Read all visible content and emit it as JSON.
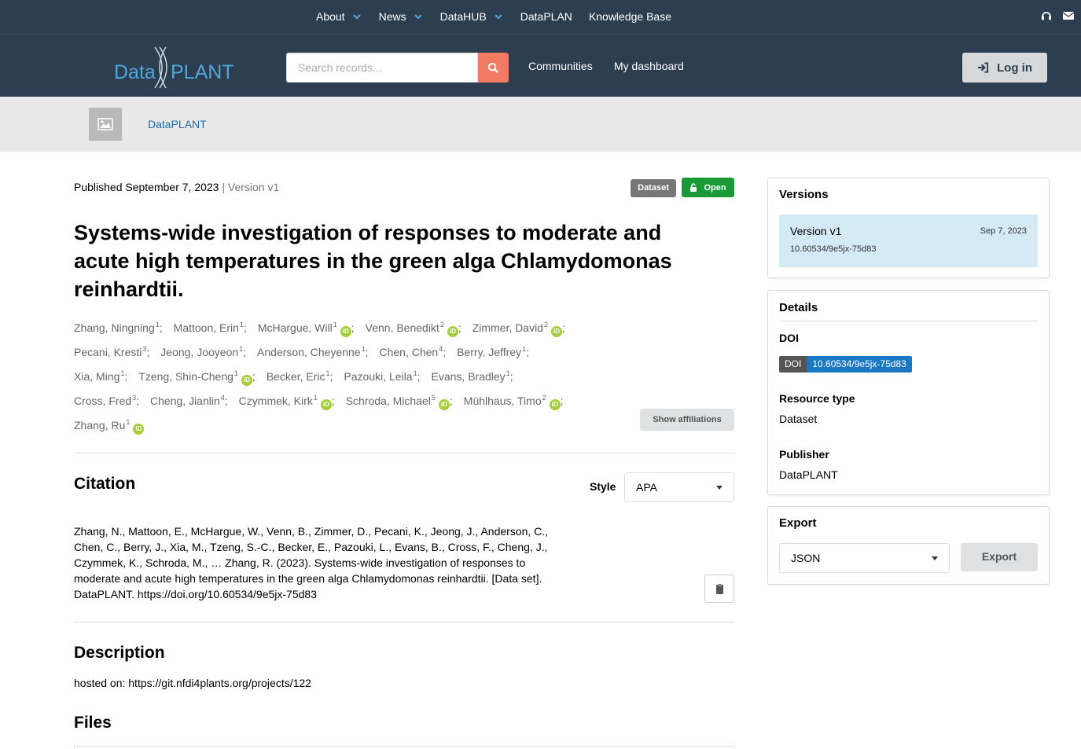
{
  "topnav": {
    "items": [
      {
        "label": "About",
        "dropdown": true
      },
      {
        "label": "News",
        "dropdown": true
      },
      {
        "label": "DataHUB",
        "dropdown": true
      },
      {
        "label": "DataPLAN",
        "dropdown": false
      },
      {
        "label": "Knowledge Base",
        "dropdown": false
      }
    ],
    "right_icons": [
      "headset-icon",
      "mail-icon"
    ]
  },
  "header": {
    "logo_text_left": "Data",
    "logo_text_right": "PLANT",
    "search_placeholder": "Search records...",
    "links": [
      "Communities",
      "My dashboard"
    ],
    "login_label": "Log in"
  },
  "community": {
    "name": "DataPLANT"
  },
  "record": {
    "published": "Published September 7, 2023",
    "version_sep": "|",
    "version": "Version v1",
    "resource_badge": "Dataset",
    "access_badge": "Open",
    "title": "Systems-wide investigation of responses to moderate and acute high temperatures in the green alga Chlamydomonas reinhardtii.",
    "authors": [
      {
        "name": "Zhang, Ningning",
        "aff": "1",
        "orcid": false
      },
      {
        "name": "Mattoon, Erin",
        "aff": "1",
        "orcid": false
      },
      {
        "name": "McHargue, Will",
        "aff": "1",
        "orcid": true
      },
      {
        "name": "Venn, Benedikt",
        "aff": "2",
        "orcid": true
      },
      {
        "name": "Zimmer, David",
        "aff": "2",
        "orcid": true
      },
      {
        "name": "Pecani, Kresti",
        "aff": "3",
        "orcid": false
      },
      {
        "name": "Jeong, Jooyeon",
        "aff": "1",
        "orcid": false
      },
      {
        "name": "Anderson, Cheyenne",
        "aff": "1",
        "orcid": false
      },
      {
        "name": "Chen, Chen",
        "aff": "4",
        "orcid": false
      },
      {
        "name": "Berry, Jeffrey",
        "aff": "1",
        "orcid": false
      },
      {
        "name": "Xia, Ming",
        "aff": "1",
        "orcid": false
      },
      {
        "name": "Tzeng, Shin-Cheng",
        "aff": "1",
        "orcid": true
      },
      {
        "name": "Becker, Eric",
        "aff": "1",
        "orcid": false
      },
      {
        "name": "Pazouki, Leila",
        "aff": "1",
        "orcid": false
      },
      {
        "name": "Evans, Bradley",
        "aff": "1",
        "orcid": false
      },
      {
        "name": "Cross, Fred",
        "aff": "3",
        "orcid": false
      },
      {
        "name": "Cheng, Jianlin",
        "aff": "4",
        "orcid": false
      },
      {
        "name": "Czymmek, Kirk",
        "aff": "1",
        "orcid": true
      },
      {
        "name": "Schroda, Michael",
        "aff": "5",
        "orcid": true
      },
      {
        "name": "Mühlhaus, Timo",
        "aff": "2",
        "orcid": true
      },
      {
        "name": "Zhang, Ru",
        "aff": "1",
        "orcid": true
      }
    ],
    "show_affiliations_label": "Show affiliations"
  },
  "citation": {
    "heading": "Citation",
    "style_label": "Style",
    "style_value": "APA",
    "text": "Zhang, N., Mattoon, E., McHargue, W., Venn, B., Zimmer, D., Pecani, K., Jeong, J., Anderson, C., Chen, C., Berry, J., Xia, M., Tzeng, S.-C., Becker, E., Pazouki, L., Evans, B., Cross, F., Cheng, J., Czymmek, K., Schroda, M., … Zhang, R. (2023). Systems-wide investigation of responses to moderate and acute high temperatures in the green alga Chlamydomonas reinhardtii. [Data set]. DataPLANT. https://doi.org/10.60534/9e5jx-75d83"
  },
  "description": {
    "heading": "Description",
    "text": "hosted on: https://git.nfdi4plants.org/projects/122"
  },
  "files": {
    "heading": "Files"
  },
  "versions": {
    "heading": "Versions",
    "items": [
      {
        "name": "Version v1",
        "date": "Sep 7, 2023",
        "doi": "10.60534/9e5jx-75d83"
      }
    ]
  },
  "details": {
    "heading": "Details",
    "doi_label": "DOI",
    "doi_badge_left": "DOI",
    "doi_badge_right": "10.60534/9e5jx-75d83",
    "resource_type_label": "Resource type",
    "resource_type_value": "Dataset",
    "publisher_label": "Publisher",
    "publisher_value": "DataPLANT"
  },
  "export": {
    "heading": "Export",
    "format_value": "JSON",
    "button_label": "Export"
  },
  "colors": {
    "navbar": "#2d3e50",
    "search_button": "#f37a62",
    "open_badge": "#1a9a36",
    "doi_badge": "#1a78c2",
    "orcid": "#a6ce39",
    "version_highlight": "#d4eaf5"
  }
}
